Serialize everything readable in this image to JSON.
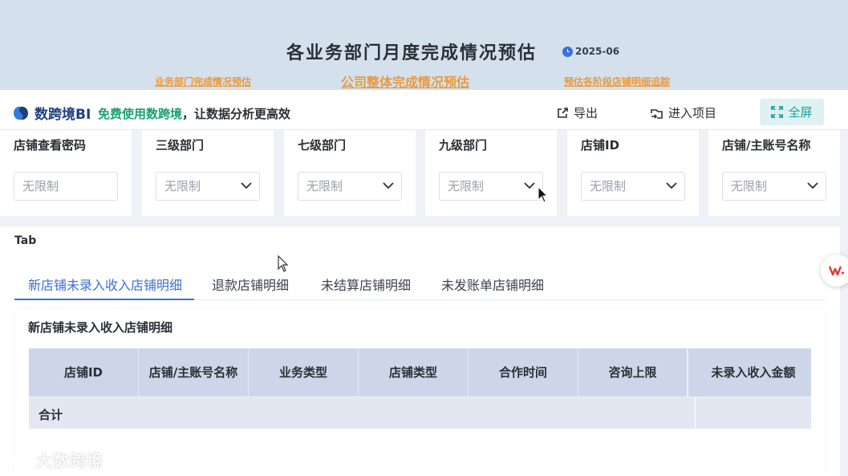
{
  "header": {
    "title": "各业务部门月度完成情况预估",
    "date": "2025-06",
    "links": [
      "业务部门完成情况预估",
      "公司整体完成情况预估",
      "预估各阶段店铺明细追踪"
    ]
  },
  "toolbar": {
    "logo_text": "数跨境BI",
    "promo_free": "免费使用数跨境",
    "promo_rest": "，让数据分析更高效",
    "export_label": "导出",
    "enter_label": "进入项目",
    "fullscreen_label": "全屏"
  },
  "filters": [
    {
      "label": "店铺查看密码",
      "value": "无限制"
    },
    {
      "label": "三级部门",
      "value": "无限制"
    },
    {
      "label": "七级部门",
      "value": "无限制"
    },
    {
      "label": "九级部门",
      "value": "无限制"
    },
    {
      "label": "店铺ID",
      "value": "无限制"
    },
    {
      "label": "店铺/主账号名称",
      "value": "无限制"
    }
  ],
  "main": {
    "tab_label": "Tab",
    "tabs": [
      "新店铺未录入收入店铺明细",
      "退款店铺明细",
      "未结算店铺明细",
      "未发账单店铺明细"
    ],
    "panel_title": "新店铺未录入收入店铺明细",
    "table": {
      "columns": [
        "店铺ID",
        "店铺/主账号名称",
        "业务类型",
        "店铺类型",
        "合作时间",
        "咨询上限",
        "未录入收入金额"
      ],
      "total_label": "合计"
    }
  },
  "watermark": "大数跨境",
  "colors": {
    "accent": "#3d6fd6",
    "link": "#e89a3c",
    "teal": "#17a2a0",
    "header_bg": "#d4e0ec"
  }
}
